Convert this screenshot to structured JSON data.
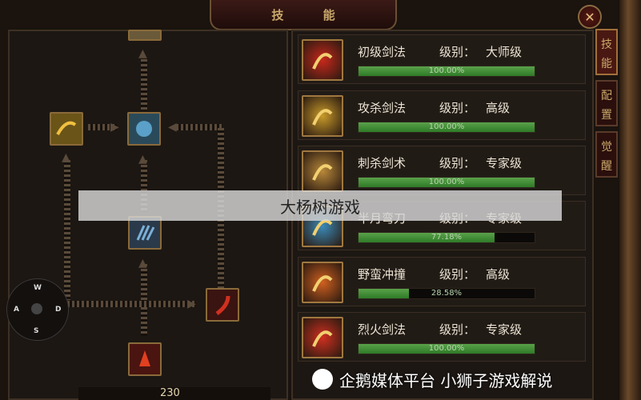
{
  "window": {
    "title": "技 能",
    "close_icon": "close-icon"
  },
  "side_tabs": [
    {
      "label": "技能",
      "active": true
    },
    {
      "label": "配置",
      "active": false
    },
    {
      "label": "觉醒",
      "active": false
    }
  ],
  "skills": [
    {
      "name": "初级剑法",
      "level_label": "级别：",
      "level": "大师级",
      "progress": 100.0,
      "progress_text": "100.00%",
      "icon": "flame-figure-icon",
      "color": "#c8281c"
    },
    {
      "name": "攻杀剑法",
      "level_label": "级别：",
      "level": "高级",
      "progress": 100.0,
      "progress_text": "100.00%",
      "icon": "golden-slash-icon",
      "color": "#c89a2a"
    },
    {
      "name": "刺杀剑术",
      "level_label": "级别：",
      "level": "专家级",
      "progress": 100.0,
      "progress_text": "100.00%",
      "icon": "thrust-sword-icon",
      "color": "#b8883a"
    },
    {
      "name": "半月弯刀",
      "level_label": "级别：",
      "level": "专家级",
      "progress": 77.18,
      "progress_text": "77.18%",
      "icon": "crescent-blade-icon",
      "color": "#3a8ab8"
    },
    {
      "name": "野蛮冲撞",
      "level_label": "级别：",
      "level": "高级",
      "progress": 28.58,
      "progress_text": "28.58%",
      "icon": "charge-burst-icon",
      "color": "#d06020"
    },
    {
      "name": "烈火剑法",
      "level_label": "级别：",
      "level": "专家级",
      "progress": 100.0,
      "progress_text": "100.00%",
      "icon": "fire-sword-icon",
      "color": "#d03020"
    }
  ],
  "joystick": {
    "up": "W",
    "left": "A",
    "down": "S",
    "right": "D"
  },
  "watermark": "大杨树游戏",
  "credit": "企鹅媒体平台 小狮子游戏解说",
  "bottom_number": "230"
}
